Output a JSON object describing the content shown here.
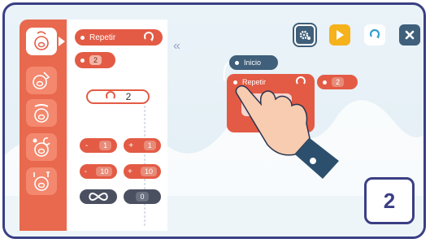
{
  "palette": {
    "repeat_label": "Repetir",
    "repeat_count": "2",
    "loop_count": "2",
    "minus_one": "1",
    "plus_one": "1",
    "minus_ten": "10",
    "plus_ten": "10",
    "zero": "0",
    "minus_sign": "-",
    "plus_sign": "+"
  },
  "workspace": {
    "start_label": "Inicio",
    "repeat_label": "Repetir",
    "repeat_count": "2"
  },
  "badge": {
    "number": "2"
  },
  "colors": {
    "accent_red": "#e35b45",
    "frame_navy": "#3a3f84",
    "play_yellow": "#f6b21b"
  },
  "icons": [
    "pig-face-icon",
    "pig-tap-icon",
    "pig-shake-icon",
    "pig-night-icon",
    "pig-music-icon",
    "settings-icon",
    "play-icon",
    "restart-icon",
    "close-icon",
    "infinity-icon",
    "repeat-icon",
    "collapse-icon",
    "pointing-hand-icon"
  ]
}
